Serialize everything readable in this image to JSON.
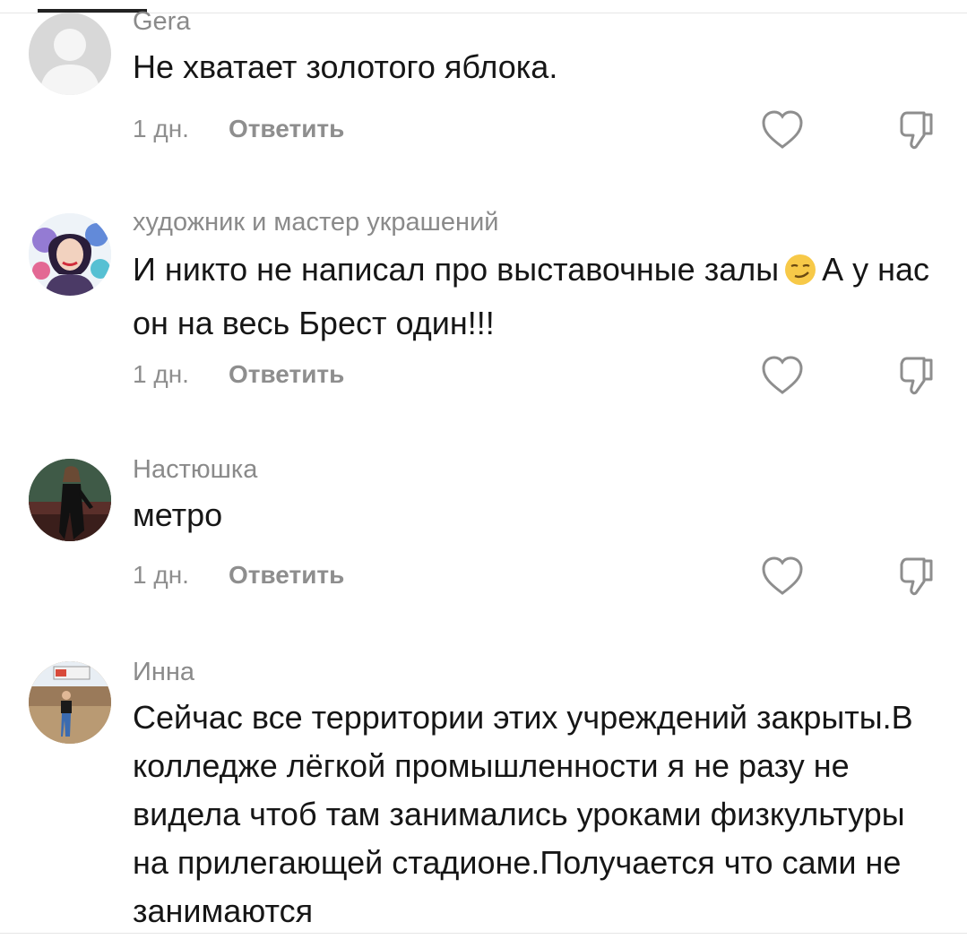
{
  "comments": [
    {
      "author": "Gera",
      "text": "Не хватает золотого яблока.",
      "time": "1 дн.",
      "reply_label": "Ответить",
      "avatar": "default-person-avatar"
    },
    {
      "author": "художник и мастер украшений",
      "text_part1": "И никто не написал про выставочные залы",
      "emoji": "smirking-face-emoji",
      "text_part2": "А у нас он на весь Брест один!!!",
      "time": "1 дн.",
      "reply_label": "Ответить",
      "avatar": "artist-portrait-avatar"
    },
    {
      "author": "Настюшка",
      "text": "метро",
      "time": "1 дн.",
      "reply_label": "Ответить",
      "avatar": "woman-photo-avatar"
    },
    {
      "author": "Инна",
      "text": "Сейчас все территории этих учреждений закрыты.В колледже лёгкой промышленности я не разу не видела чтоб там занимались уроками физкультуры на прилегающей стадионе.Получается что сами не занимаются",
      "avatar": "outdoor-photo-avatar"
    }
  ],
  "icons": {
    "like": "heart-outline-icon",
    "dislike": "thumb-down-outline-icon"
  },
  "colors": {
    "meta_text": "#8e8e8e",
    "body_text": "#161616",
    "emoji": "#f7c948"
  }
}
